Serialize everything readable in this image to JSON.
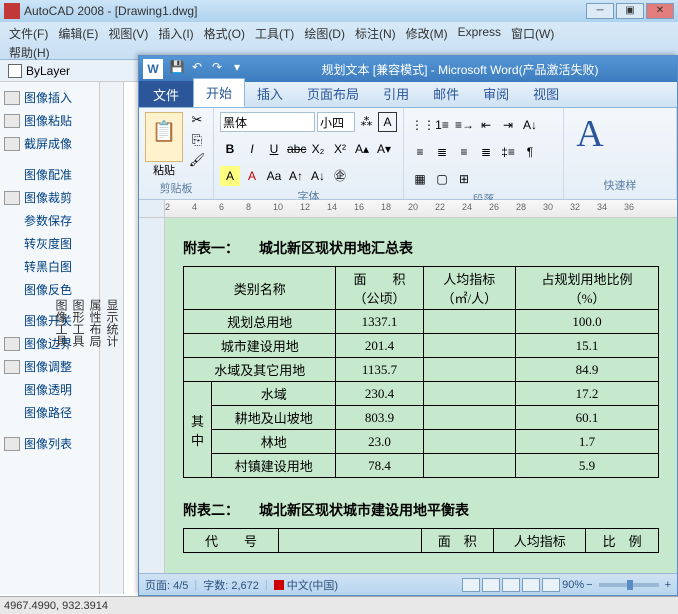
{
  "acad": {
    "title": "AutoCAD 2008 - [Drawing1.dwg]",
    "menu": [
      "文件(F)",
      "编辑(E)",
      "视图(V)",
      "插入(I)",
      "格式(O)",
      "工具(T)",
      "绘图(D)",
      "标注(N)",
      "修改(M)",
      "Express",
      "窗口(W)"
    ],
    "help": "帮助(H)",
    "bylayer": "ByLayer",
    "sidebar": [
      "图像插入",
      "图像粘贴",
      "截屏成像",
      "图像配准",
      "图像裁剪",
      "参数保存",
      "转灰度图",
      "转黑白图",
      "图像反色",
      "图像开关",
      "图像边界",
      "图像调整",
      "图像透明",
      "图像路径",
      "图像列表"
    ],
    "vbar": [
      "显示统计",
      "属性布局",
      "图形工具",
      "图像工具"
    ],
    "coords": "4967.4990, 932.3914"
  },
  "word": {
    "title": "规划文本 [兼容模式] - Microsoft Word(产品激活失败)",
    "tabs": {
      "file": "文件",
      "items": [
        "开始",
        "插入",
        "页面布局",
        "引用",
        "邮件",
        "审阅",
        "视图"
      ]
    },
    "ribbon": {
      "clipboard": "剪贴板",
      "paste": "粘贴",
      "font_group": "字体",
      "font_name": "黑体",
      "font_size": "小四",
      "para": "段落",
      "style": "快速样"
    },
    "ruler_nums": [
      "2",
      "4",
      "6",
      "8",
      "10",
      "12",
      "14",
      "16",
      "18",
      "20",
      "22",
      "24",
      "26",
      "28",
      "30",
      "32",
      "34",
      "36"
    ],
    "status": {
      "page": "页面: 4/5",
      "words": "字数: 2,672",
      "lang": "中文(中国)",
      "zoom": "90%"
    }
  },
  "doc": {
    "cap1_a": "附表一：",
    "cap1_b": "城北新区现状用地汇总表",
    "cap2_a": "附表二：",
    "cap2_b": "城北新区现状城市建设用地平衡表",
    "th": {
      "name": "类别名称",
      "area_l1": "面　　积",
      "area_l2": "（公顷）",
      "per_l1": "人均指标",
      "per_l2": "（㎡/人）",
      "pct_l1": "占规划用地比例",
      "pct_l2": "（%）"
    },
    "merged": "其中",
    "rows": [
      {
        "name": "规划总用地",
        "area": "1337.1",
        "per": "",
        "pct": "100.0"
      },
      {
        "name": "城市建设用地",
        "area": "201.4",
        "per": "",
        "pct": "15.1"
      },
      {
        "name": "水域及其它用地",
        "area": "1135.7",
        "per": "",
        "pct": "84.9"
      }
    ],
    "subrows": [
      {
        "name": "水域",
        "area": "230.4",
        "per": "",
        "pct": "17.2"
      },
      {
        "name": "耕地及山坡地",
        "area": "803.9",
        "per": "",
        "pct": "60.1"
      },
      {
        "name": "林地",
        "area": "23.0",
        "per": "",
        "pct": "1.7"
      },
      {
        "name": "村镇建设用地",
        "area": "78.4",
        "per": "",
        "pct": "5.9"
      }
    ],
    "t2": {
      "code": "代　　号",
      "area": "面　积",
      "per": "人均指标",
      "ratio": "比　例"
    }
  }
}
